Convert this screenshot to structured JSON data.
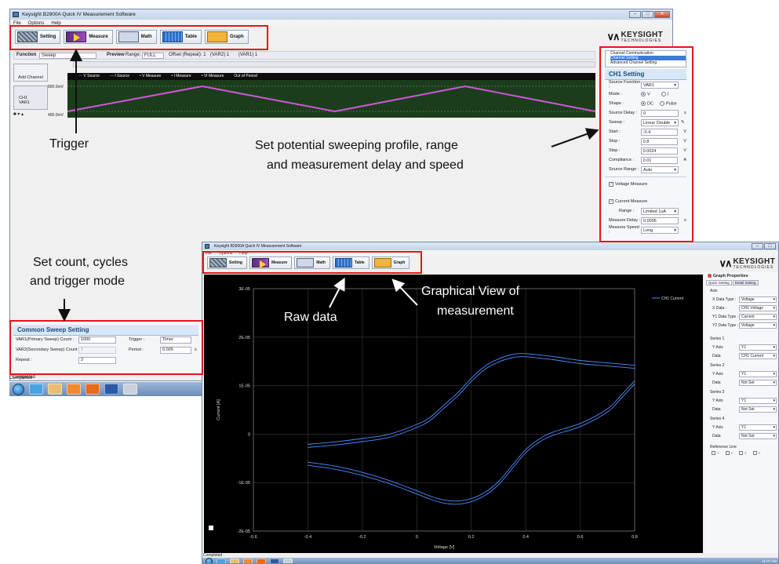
{
  "top_window": {
    "title": "Keysight B2900A Quick IV Measurement Software",
    "menu": [
      "File",
      "Options",
      "Help"
    ],
    "toolbar": [
      {
        "label": "Setting",
        "icon": "setting-icon"
      },
      {
        "label": "Measure",
        "icon": "measure-icon"
      },
      {
        "label": "Math",
        "icon": "math-icon"
      },
      {
        "label": "Table",
        "icon": "table-icon"
      },
      {
        "label": "Graph",
        "icon": "graph-icon"
      }
    ],
    "function_label": "Function",
    "function_value": "Sweep",
    "preview_label": "Preview",
    "range_label": "Range:",
    "range_value": "FULL",
    "offset_text": "Offset (Repeat): 1",
    "var2_text": "(VAR2) 1",
    "var1_text": "(VAR1) 1",
    "add_channel": "Add Channel",
    "channel_name": "CH1",
    "channel_var": "VAR1",
    "level_high": "800.0mV",
    "level_low": "400.0mV",
    "legend": [
      "V Source",
      "I Source",
      "V Measure",
      "I Measure",
      "VI Measure",
      "Out of Period"
    ],
    "status": "Completed"
  },
  "logo": {
    "brand": "KEYSIGHT",
    "sub": "TECHNOLOGIES"
  },
  "ch1_panel": {
    "tree": [
      "Channel Communication",
      "Channel Setting",
      "Advanced Channel Setting"
    ],
    "title": "CH1 Setting",
    "rows": [
      {
        "label": "Source Function :",
        "value": "VAR1",
        "unit": ""
      },
      {
        "label": "Source Delay :",
        "value": "0",
        "unit": "s"
      },
      {
        "label": "Sweep :",
        "value": "Linear Double",
        "unit": ""
      },
      {
        "label": "Start :",
        "value": "-0.4",
        "unit": "V"
      },
      {
        "label": "Stop :",
        "value": "0.8",
        "unit": "V"
      },
      {
        "label": "Step :",
        "value": "0.0024",
        "unit": "V"
      },
      {
        "label": "Compliance :",
        "value": "0.01",
        "unit": "A"
      },
      {
        "label": "Source Range :",
        "value": "Auto",
        "unit": ""
      }
    ],
    "mode_label": "Mode :",
    "mode_v": "V",
    "mode_i": "I",
    "shape_label": "Shape :",
    "shape_dc": "DC",
    "shape_pulse": "Pulse",
    "voltage_measure": "Voltage Measure",
    "current_measure": "Current Measure",
    "range_label": "Range :",
    "range_value": "Limited 1uA",
    "measure_delay_label": "Measure Delay :",
    "measure_delay_value": "0.0005",
    "measure_delay_unit": "s",
    "measure_speed_label": "Measure Speed :",
    "measure_speed_value": "Long"
  },
  "common_sweep": {
    "title": "Common Sweep Setting",
    "var1_label": "VAR1(Primary Sweep) Count :",
    "var1_value": "1000",
    "var2_label": "VAR2(Secondary Sweep) Count :",
    "var2_value": "1",
    "repeat_label": "Repeat :",
    "repeat_value": "2",
    "trigger_label": "Trigger :",
    "trigger_value": "Timer",
    "period_label": "Period :",
    "period_value": "0.005",
    "period_unit": "s"
  },
  "bottom_window": {
    "title": "Keysight B2900A Quick IV Measurement Software",
    "menu": [
      "File",
      "Options",
      "Help"
    ],
    "toolbar": [
      {
        "label": "Setting",
        "icon": "setting-icon"
      },
      {
        "label": "Measure",
        "icon": "measure-icon"
      },
      {
        "label": "Math",
        "icon": "math-icon"
      },
      {
        "label": "Table",
        "icon": "table-icon"
      },
      {
        "label": "Graph",
        "icon": "graph-icon"
      }
    ],
    "status": "Completed",
    "clock": "11:07 AM"
  },
  "graph_props": {
    "title": "Graph Properties",
    "tabs": [
      "Quick Setting",
      "Detail Setting"
    ],
    "axis_section": "Axis",
    "axis_rows": [
      {
        "label": "X Data Type :",
        "value": "Voltage"
      },
      {
        "label": "X Data :",
        "value": "CH1 Voltage"
      },
      {
        "label": "Y1 Data Type :",
        "value": "Current"
      },
      {
        "label": "Y2 Data Type :",
        "value": "Voltage"
      }
    ],
    "series": [
      {
        "name": "Series 1",
        "y_axis": "Y1",
        "data": "CH1 Current"
      },
      {
        "name": "Series 2",
        "y_axis": "Y1",
        "data": "Not Set"
      },
      {
        "name": "Series 3",
        "y_axis": "Y1",
        "data": "Not Set"
      },
      {
        "name": "Series 4",
        "y_axis": "Y1",
        "data": "Not Set"
      }
    ],
    "y_axis_label": "Y Axis",
    "data_label": "Data",
    "reference_line": "Reference Line",
    "ref_items": [
      "1",
      "2",
      "3",
      "4"
    ]
  },
  "annotations": {
    "trigger": "Trigger",
    "sweep_line1": "Set potential sweeping profile, range",
    "sweep_line2": "and measurement delay and speed",
    "count_line1": "Set count, cycles",
    "count_line2": "and trigger mode",
    "raw_data": "Raw data",
    "graph_line1": "Graphical View of",
    "graph_line2": "measurement"
  },
  "chart_data": {
    "type": "line",
    "xlabel": "Voltage [V]",
    "ylabel": "Current [A]",
    "xlim": [
      -0.6,
      0.8
    ],
    "ylim": [
      -2e-05,
      3e-05
    ],
    "x_ticks": [
      "-0.6",
      "-0.4",
      "-0.2",
      "0",
      "0.2",
      "0.4",
      "0.6",
      "0.8"
    ],
    "y_ticks": [
      "3E-05",
      "2E-05",
      "1E-05",
      "0",
      "-1E-05",
      "-2E-05"
    ],
    "grid": true,
    "legend_position": "top-right",
    "line_color": "#4a8cff",
    "series": [
      {
        "name": "CH1 Current",
        "forward": {
          "x": [
            -0.4,
            -0.3,
            -0.2,
            -0.1,
            0.0,
            0.05,
            0.1,
            0.15,
            0.2,
            0.25,
            0.3,
            0.35,
            0.4,
            0.5,
            0.6,
            0.7,
            0.8
          ],
          "y": [
            -2.1e-06,
            -1.6e-06,
            -9e-07,
            0.0,
            2e-06,
            3.5e-06,
            6e-06,
            8.5e-06,
            1.15e-05,
            1.4e-05,
            1.55e-05,
            1.64e-05,
            1.66e-05,
            1.6e-05,
            1.52e-05,
            1.47e-05,
            1.42e-05
          ]
        },
        "reverse": {
          "x": [
            0.8,
            0.75,
            0.7,
            0.6,
            0.5,
            0.45,
            0.4,
            0.35,
            0.3,
            0.25,
            0.2,
            0.15,
            0.1,
            0.05,
            0.0,
            -0.1,
            -0.2,
            -0.3,
            -0.4
          ],
          "y": [
            1.1e-05,
            8e-06,
            5.2e-06,
            2.2e-06,
            4e-07,
            -1e-06,
            -3.2e-06,
            -6.5e-06,
            -9.8e-06,
            -1.2e-05,
            -1.33e-05,
            -1.38e-05,
            -1.36e-05,
            -1.28e-05,
            -1.17e-05,
            -9.6e-06,
            -7.9e-06,
            -6.6e-06,
            -5.8e-06
          ]
        }
      }
    ]
  }
}
